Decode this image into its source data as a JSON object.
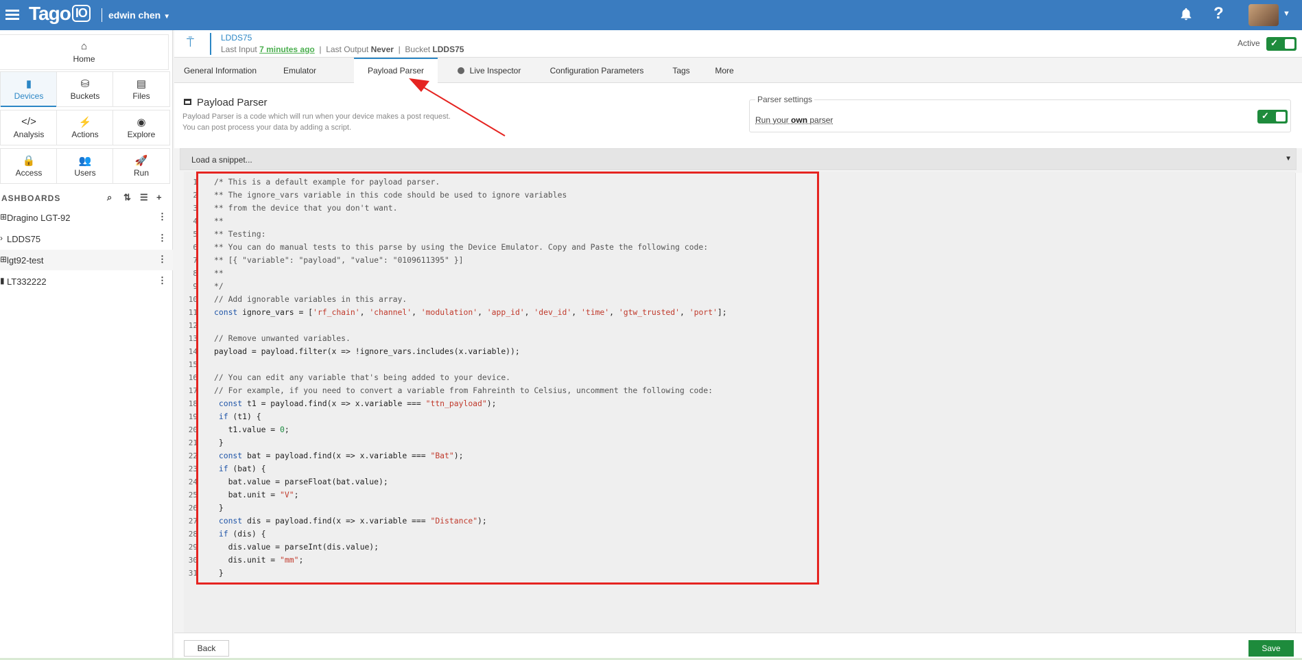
{
  "app": {
    "logo": "Tago",
    "logo_io": "IO",
    "user_name": "edwin chen"
  },
  "sidebar": {
    "home_label": "Home",
    "nav": [
      {
        "label": "Devices",
        "icon": "device-icon",
        "glyph": "▮"
      },
      {
        "label": "Buckets",
        "icon": "bucket-icon",
        "glyph": "⛁"
      },
      {
        "label": "Files",
        "icon": "file-icon",
        "glyph": "▤"
      },
      {
        "label": "Analysis",
        "icon": "code-icon",
        "glyph": "</>"
      },
      {
        "label": "Actions",
        "icon": "bolt-icon",
        "glyph": "⚡"
      },
      {
        "label": "Explore",
        "icon": "compass-icon",
        "glyph": "◉"
      },
      {
        "label": "Access",
        "icon": "lock-icon",
        "glyph": "🔒"
      },
      {
        "label": "Users",
        "icon": "users-icon",
        "glyph": "👥"
      },
      {
        "label": "Run",
        "icon": "rocket-icon",
        "glyph": "🚀"
      }
    ],
    "dashboards_header": "ASHBOARDS",
    "dashboards": [
      {
        "name": "Dragino LGT-92"
      },
      {
        "name": "LDDS75"
      },
      {
        "name": "lgt92-test"
      },
      {
        "name": "LT332222"
      }
    ]
  },
  "device": {
    "name": "LDDS75",
    "last_input_label": "Last Input",
    "last_input_value": "7 minutes ago",
    "last_output_label": "Last Output",
    "last_output_value": "Never",
    "bucket_label": "Bucket",
    "bucket_value": "LDDS75",
    "active_label": "Active",
    "active": true
  },
  "tabs": [
    {
      "label": "General Information"
    },
    {
      "label": "Emulator"
    },
    {
      "label": "Payload Parser",
      "active": true
    },
    {
      "label": "Live Inspector"
    },
    {
      "label": "Configuration Parameters"
    },
    {
      "label": "Tags"
    },
    {
      "label": "More"
    }
  ],
  "parser": {
    "title": "Payload Parser",
    "desc1": "Payload Parser is a code which will run when your device makes a post request.",
    "desc2": "You can post process your data by adding a script.",
    "settings_legend": "Parser settings",
    "run_own_pre": "Run your ",
    "run_own_bold": "own",
    "run_own_post": " parser",
    "run_own_enabled": true,
    "snippet_placeholder": "Load a snippet..."
  },
  "code_lines": [
    "/* This is a default example for payload parser.",
    "** The ignore_vars variable in this code should be used to ignore variables",
    "** from the device that you don't want.",
    "**",
    "** Testing:",
    "** You can do manual tests to this parse by using the Device Emulator. Copy and Paste the following code:",
    "** [{ \"variable\": \"payload\", \"value\": \"0109611395\" }]",
    "**",
    "*/",
    "// Add ignorable variables in this array.",
    "const ignore_vars = ['rf_chain', 'channel', 'modulation', 'app_id', 'dev_id', 'time', 'gtw_trusted', 'port'];",
    "",
    "// Remove unwanted variables.",
    "payload = payload.filter(x => !ignore_vars.includes(x.variable));",
    "",
    "// You can edit any variable that's being added to your device.",
    "// For example, if you need to convert a variable from Fahreinth to Celsius, uncomment the following code:",
    " const t1 = payload.find(x => x.variable === \"ttn_payload\");",
    " if (t1) {",
    "   t1.value = 0;",
    " }",
    " const bat = payload.find(x => x.variable === \"Bat\");",
    " if (bat) {",
    "   bat.value = parseFloat(bat.value);",
    "   bat.unit = \"V\";",
    " }",
    " const dis = payload.find(x => x.variable === \"Distance\");",
    " if (dis) {",
    "   dis.value = parseInt(dis.value);",
    "   dis.unit = \"mm\";",
    " }"
  ],
  "footer": {
    "back_label": "Back",
    "save_label": "Save"
  },
  "colors": {
    "topbar": "#3a7cc0",
    "accent": "#2b86c5",
    "toggle_on": "#1e8b3c",
    "highlight_box": "#e52421"
  }
}
